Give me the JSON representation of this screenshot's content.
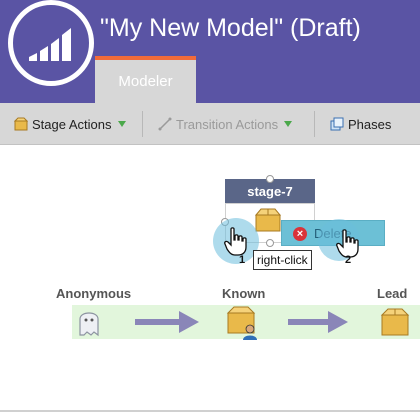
{
  "header": {
    "title": "\"My New Model\" (Draft)",
    "bg_color": "#5a54a4",
    "logo_icon": "marketo-logo-icon"
  },
  "tabs": [
    {
      "label": "Modeler",
      "active": true
    }
  ],
  "toolbar": {
    "stage_actions_label": "Stage Actions",
    "transition_actions_label": "Transition Actions",
    "phases_label": "Phases"
  },
  "canvas": {
    "stage": {
      "name": "stage-7"
    },
    "context_menu": {
      "delete_label": "Delete"
    },
    "tooltip": "right-click",
    "step_badges": [
      "1",
      "2"
    ],
    "phases": [
      {
        "label": "Anonymous",
        "icon": "ghost-icon"
      },
      {
        "label": "Known",
        "icon": "box-person-icon"
      },
      {
        "label": "Lead",
        "icon": "box-icon"
      }
    ]
  },
  "colors": {
    "accent": "#f26b3a",
    "click_highlight": "#6cbedc",
    "phase_band": "#e2f6dc"
  }
}
